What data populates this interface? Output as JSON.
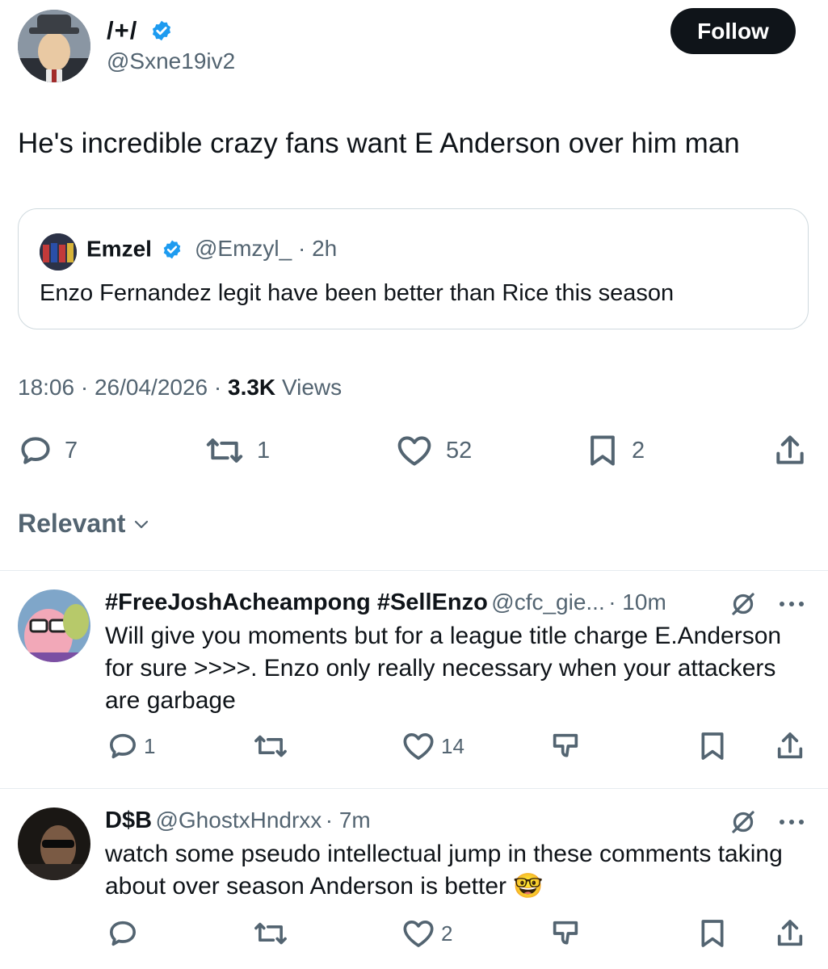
{
  "tweet": {
    "author_name": "/+/",
    "author_handle": "@Sxne19iv2",
    "follow_label": "Follow",
    "text": "He's incredible crazy fans want E Anderson over him man",
    "quote": {
      "name": "Emzel",
      "handle": "@Emzyl_",
      "time": "· 2h",
      "text": "Enzo Fernandez legit have been better than Rice this season"
    },
    "time": "18:06",
    "date": "26/04/2026",
    "views_count": "3.3K",
    "views_label": "Views",
    "replies": "7",
    "reposts": "1",
    "likes": "52",
    "bookmarks": "2"
  },
  "sort_label": "Relevant",
  "replies": [
    {
      "name": "#FreeJoshAcheampong #SellEnzo",
      "handle": "@cfc_gie...",
      "time": "· 10m",
      "text": "Will give you moments but for a league title charge E.Anderson for sure >>>>. Enzo only really necessary when your attackers are garbage",
      "replies": "1",
      "likes": "14"
    },
    {
      "name": "D$B",
      "handle": "@GhostxHndrxx",
      "time": "· 7m",
      "text": "watch some pseudo intellectual jump in these comments taking about over season Anderson is better",
      "emoji": "🤓",
      "likes": "2"
    }
  ],
  "colors": {
    "verified": "#1d9bf0",
    "text_primary": "#0f1419",
    "text_secondary": "#536471",
    "follow_bg": "#0f1419"
  },
  "icons": [
    "verified-badge-icon",
    "reply-icon",
    "repost-icon",
    "like-icon",
    "bookmark-icon",
    "share-icon",
    "chevron-down-icon",
    "grok-icon",
    "more-icon",
    "dislike-icon"
  ]
}
